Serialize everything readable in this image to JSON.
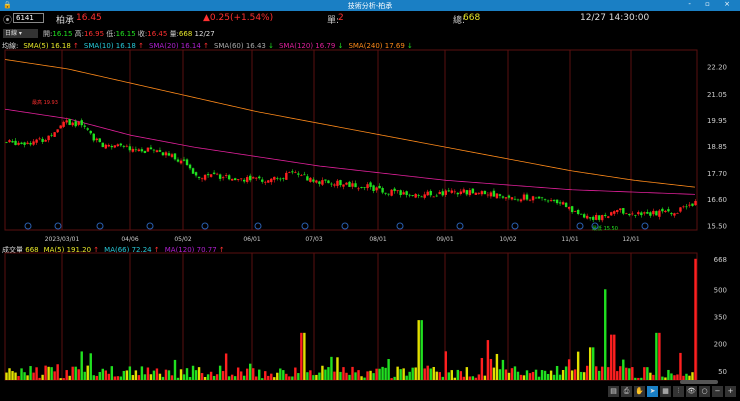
{
  "window": {
    "title": "技術分析-柏承",
    "controls": "- ▫ ×"
  },
  "quote": {
    "code": "6141",
    "name": "柏承",
    "price": "16.45",
    "change": "▲0.25(+1.54%)",
    "single_label": "單:",
    "single": "2",
    "total_label": "總:",
    "total": "668",
    "time": "12/27 14:30:00"
  },
  "ohlc": {
    "period": "日線",
    "open_label": "開:",
    "open": "16.15",
    "high_label": "高:",
    "high": "16.95",
    "low_label": "低:",
    "low": "16.15",
    "close_label": "收:",
    "close": "16.45",
    "vol_label": "量:",
    "vol": "668",
    "date": "12/27"
  },
  "ma_legend": {
    "label": "均線:",
    "items": [
      {
        "text": "SMA(5) 16.18",
        "arrow": "↑",
        "color": "#e8e82a"
      },
      {
        "text": "SMA(10) 16.18",
        "arrow": "↑",
        "color": "#27c8d8"
      },
      {
        "text": "SMA(20) 16.14",
        "arrow": "↑",
        "color": "#b020d0"
      },
      {
        "text": "SMA(60) 16.43",
        "arrow": "↓",
        "color": "#aaaaaa"
      },
      {
        "text": "SMA(120) 16.79",
        "arrow": "↓",
        "color": "#e0209a"
      },
      {
        "text": "SMA(240) 17.69",
        "arrow": "↓",
        "color": "#ff8a1a"
      }
    ]
  },
  "vol_legend": {
    "label": "成交量",
    "value": "668",
    "items": [
      {
        "text": "MA(5) 191.20",
        "arrow": "↑",
        "color": "#e8e82a"
      },
      {
        "text": "MA(66) 72.24",
        "arrow": "↑",
        "color": "#27c8d8"
      },
      {
        "text": "MA(120) 70.77",
        "arrow": "↑",
        "color": "#b020d0"
      }
    ]
  },
  "colors": {
    "up": "#ff2020",
    "down": "#20e020",
    "flat": "#e0e000",
    "grid": "#5a1010"
  },
  "chart_data": [
    {
      "type": "candlestick",
      "price_ticks": [
        "22.20",
        "21.05",
        "19.95",
        "18.85",
        "17.70",
        "16.60",
        "15.50"
      ],
      "ylim": [
        15.3,
        22.9
      ],
      "x_ticks": [
        "2023/03/01",
        "04/06",
        "05/02",
        "06/01",
        "07/03",
        "08/01",
        "09/01",
        "10/02",
        "11/01",
        "12/01"
      ],
      "close_path": [
        19.0,
        19.0,
        19.1,
        19.9,
        19.7,
        18.8,
        18.8,
        18.7,
        18.6,
        18.3,
        17.6,
        17.6,
        17.5,
        17.4,
        17.45,
        17.7,
        17.4,
        17.3,
        17.2,
        17.1,
        16.9,
        16.8,
        16.8,
        16.85,
        16.9,
        16.9,
        16.7,
        16.7,
        16.6,
        16.5,
        15.9,
        15.8,
        16.1,
        16.0,
        16.0,
        16.1,
        16.45
      ],
      "sma240_path": [
        22.5,
        22.1,
        21.5,
        20.9,
        20.3,
        19.8,
        19.3,
        18.8,
        18.3,
        17.8,
        17.4,
        17.1
      ],
      "sma120_path": [
        20.4,
        20.0,
        19.3,
        18.8,
        18.4,
        18.0,
        17.7,
        17.4,
        17.2,
        17.0,
        16.9,
        16.8
      ],
      "annotations": {
        "high": "最高 19.93",
        "low": "最低 15.50"
      }
    },
    {
      "type": "bar",
      "name": "成交量",
      "y_ticks": [
        "668",
        "500",
        "350",
        "200",
        "50"
      ],
      "ylim": [
        0,
        700
      ],
      "spikes": [
        {
          "at": 0.43,
          "v": 260
        },
        {
          "at": 0.6,
          "v": 330
        },
        {
          "at": 0.7,
          "v": 220
        },
        {
          "at": 0.85,
          "v": 180
        },
        {
          "at": 0.87,
          "v": 500
        },
        {
          "at": 0.88,
          "v": 250
        },
        {
          "at": 0.945,
          "v": 260
        },
        {
          "at": 1.0,
          "v": 668
        }
      ]
    }
  ],
  "toolbar": [
    "▤",
    "⎙",
    "✋",
    "➤",
    "▦",
    "⫶",
    "👁",
    "○",
    "−",
    "+"
  ]
}
